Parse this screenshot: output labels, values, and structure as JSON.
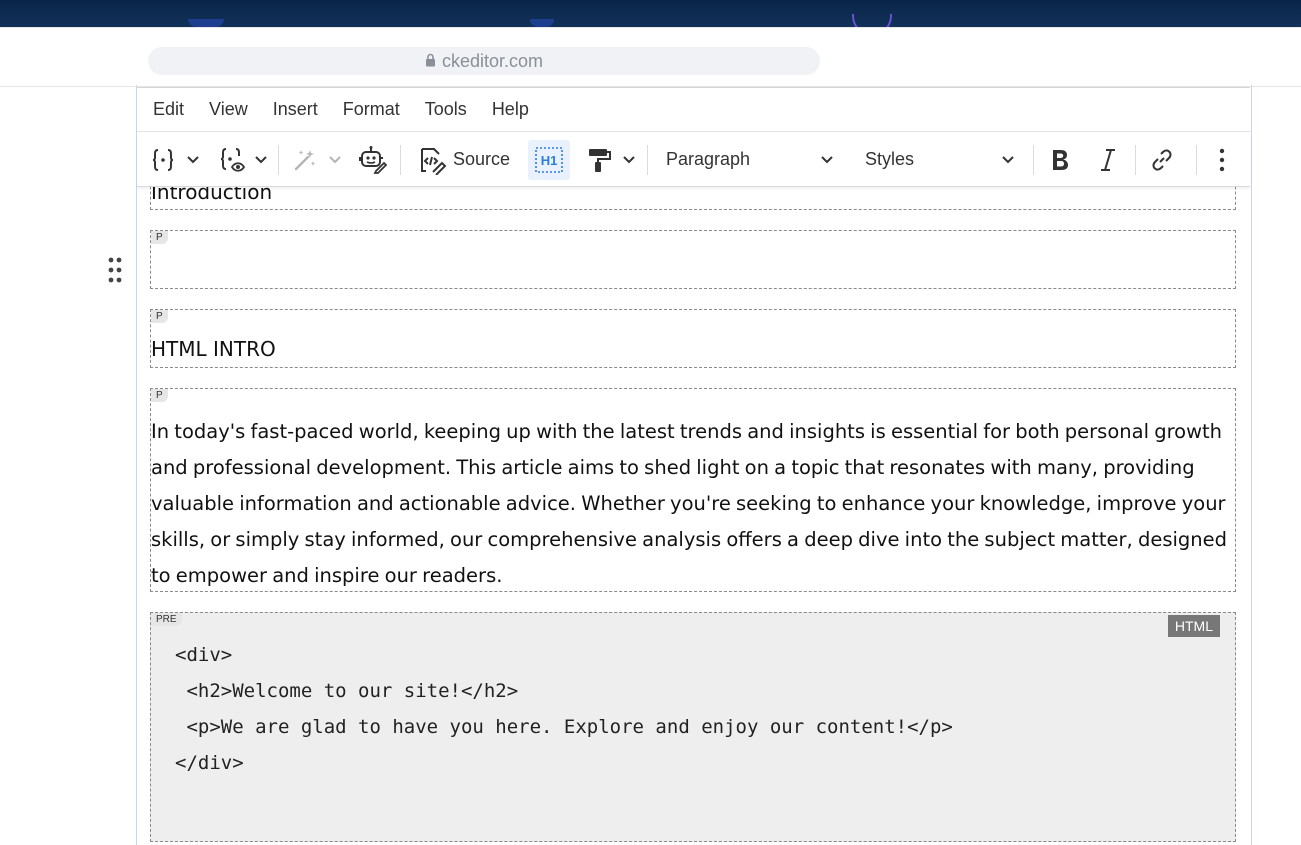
{
  "browser": {
    "url": "ckeditor.com"
  },
  "menu": {
    "items": [
      "Edit",
      "View",
      "Insert",
      "Format",
      "Tools",
      "Help"
    ]
  },
  "toolbar": {
    "source_label": "Source",
    "h1_label": "H1",
    "heading_dropdown": "Paragraph",
    "styles_dropdown": "Styles",
    "icons": [
      "insert-merge-field-icon",
      "merge-field-preview-icon",
      "ai-assistant-icon",
      "ai-chat-icon",
      "source-icon",
      "show-blocks-icon",
      "format-painter-icon",
      "bold-icon",
      "italic-icon",
      "link-icon",
      "more-options-icon"
    ]
  },
  "content": {
    "heading_text": "Introduction",
    "blocks": [
      {
        "tag": "P",
        "text": ""
      },
      {
        "tag": "P",
        "text": "HTML INTRO"
      },
      {
        "tag": "P",
        "text": "In today's fast-paced world, keeping up with the latest trends and insights is essential for both personal growth and professional development. This article aims to shed light on a topic that resonates with many, providing valuable information and actionable advice. Whether you're seeking to enhance your knowledge, improve your skills, or simply stay informed, our comprehensive analysis offers a deep dive into the subject matter, designed to empower and inspire our readers."
      }
    ],
    "code_block": {
      "tag": "PRE",
      "language": "HTML",
      "lines": [
        "<div>",
        " <h2>Welcome to our site!</h2>",
        " <p>We are glad to have you here. Explore and enjoy our content!</p>",
        "</div>"
      ]
    }
  }
}
